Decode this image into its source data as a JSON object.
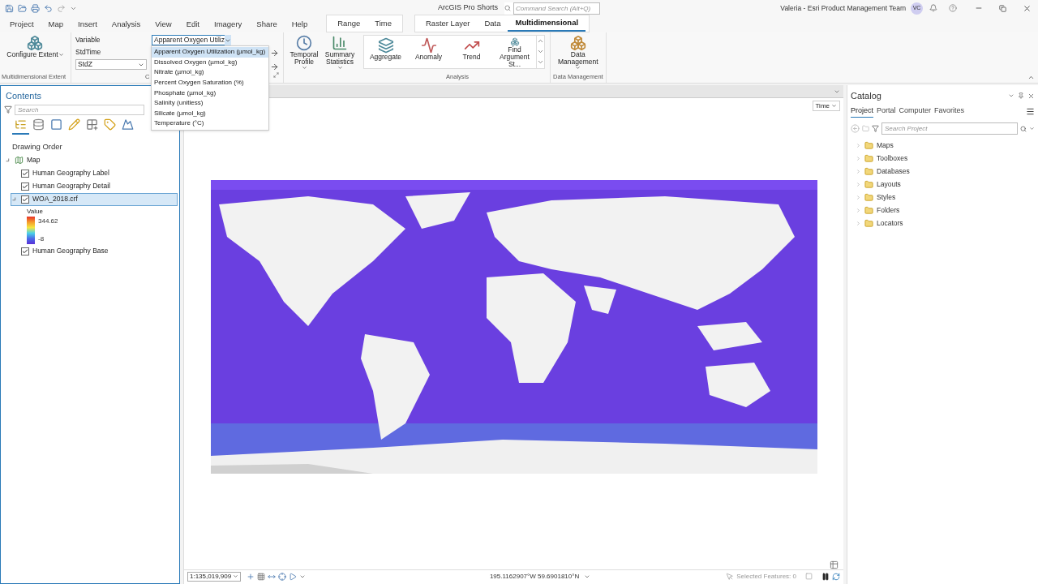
{
  "title_bar": {
    "title": "ArcGIS Pro Shorts",
    "command_search": {
      "placeholder": "Command Search (Alt+Q)"
    },
    "user": "Valeria - Esri Product Management Team",
    "avatar": "VC"
  },
  "tabs": [
    {
      "label": "Project",
      "selected": false
    },
    {
      "label": "Map",
      "selected": false
    },
    {
      "label": "Insert",
      "selected": false
    },
    {
      "label": "Analysis",
      "selected": false
    },
    {
      "label": "View",
      "selected": false
    },
    {
      "label": "Edit",
      "selected": false
    },
    {
      "label": "Imagery",
      "selected": false
    },
    {
      "label": "Share",
      "selected": false
    },
    {
      "label": "Help",
      "selected": false
    }
  ],
  "contextual_tab_groups": [
    {
      "tabs": [
        {
          "label": "Range",
          "selected": false
        },
        {
          "label": "Time",
          "selected": false
        }
      ]
    },
    {
      "tabs": [
        {
          "label": "Raster Layer",
          "selected": false
        },
        {
          "label": "Data",
          "selected": false
        },
        {
          "label": "Multidimensional",
          "selected": true
        }
      ]
    }
  ],
  "ribbon": {
    "extent_group": {
      "label": "Multidimensional Extent",
      "button": "Configure Extent"
    },
    "variable_group": {
      "label": "C",
      "variable_label": "Variable",
      "variable_value": "Apparent Oxygen Utiliz",
      "stdtime_label": "StdTime",
      "stdz_value": "StdZ"
    },
    "tools": [
      {
        "label": "Temporal Profile",
        "kind": "profile"
      },
      {
        "label": "Summary Statistics",
        "kind": "statistics"
      }
    ],
    "analysis_group": {
      "label": "Analysis",
      "gallery": [
        {
          "label": "Aggregate",
          "kind": "aggregate"
        },
        {
          "label": "Anomaly",
          "kind": "anomaly"
        },
        {
          "label": "Trend",
          "kind": "trend"
        },
        {
          "label": "Find Argument St...",
          "kind": "argument"
        }
      ]
    },
    "data_management_group": {
      "label": "Data Management",
      "button": "Data Management"
    }
  },
  "variable_dropdown": {
    "options": [
      {
        "label": "Apparent Oxygen Utilization (µmol_kg)",
        "selected": true
      },
      {
        "label": "Dissolved Oxygen (µmol_kg)",
        "selected": false
      },
      {
        "label": "Nitrate (µmol_kg)",
        "selected": false
      },
      {
        "label": "Percent Oxygen Saturation (%)",
        "selected": false
      },
      {
        "label": "Phosphate (µmol_kg)",
        "selected": false
      },
      {
        "label": "Salinity (unitless)",
        "selected": false
      },
      {
        "label": "Silicate (µmol_kg)",
        "selected": false
      },
      {
        "label": "Temperature (°C)",
        "selected": false
      }
    ]
  },
  "contents": {
    "title": "Contents",
    "search": {
      "placeholder": "Search"
    },
    "tools": [
      {
        "kind": "order",
        "selected": true
      },
      {
        "kind": "source",
        "selected": false
      },
      {
        "kind": "selection",
        "selected": false
      },
      {
        "kind": "editing",
        "selected": false
      },
      {
        "kind": "snapping",
        "selected": false
      },
      {
        "kind": "labeling",
        "selected": false
      },
      {
        "kind": "perspective",
        "selected": false
      }
    ],
    "heading": "Drawing Order",
    "layers": [
      {
        "name": "Map",
        "kind": "map",
        "expanded": true,
        "selected": false,
        "children": [
          {
            "name": "Human Geography Label",
            "checked": true,
            "selected": false
          },
          {
            "name": "Human Geography Detail",
            "checked": true,
            "selected": false
          },
          {
            "name": "WOA_2018.crf",
            "checked": true,
            "selected": true,
            "expanded": true,
            "legend": {
              "label": "Value",
              "max": "344.62",
              "min": "-8"
            }
          },
          {
            "name": "Human Geography Base",
            "checked": true,
            "selected": false
          }
        ]
      }
    ]
  },
  "map_view": {
    "time_button": "Time",
    "status_bar": {
      "scale": "1:135,019,909",
      "coordinates": "195.1162907°W 59.6901810°N",
      "selected_features": "Selected Features: 0"
    }
  },
  "catalog": {
    "title": "Catalog",
    "tabs": [
      {
        "label": "Project",
        "selected": true
      },
      {
        "label": "Portal",
        "selected": false
      },
      {
        "label": "Computer",
        "selected": false
      },
      {
        "label": "Favorites",
        "selected": false
      }
    ],
    "search": {
      "placeholder": "Search Project"
    },
    "items": [
      {
        "name": "Maps"
      },
      {
        "name": "Toolboxes"
      },
      {
        "name": "Databases"
      },
      {
        "name": "Layouts"
      },
      {
        "name": "Styles"
      },
      {
        "name": "Folders"
      },
      {
        "name": "Locators"
      }
    ]
  }
}
